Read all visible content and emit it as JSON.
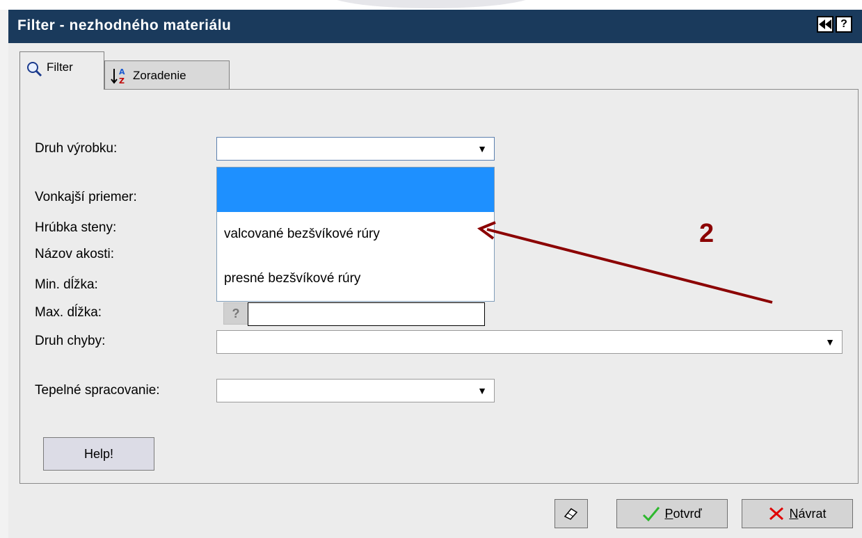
{
  "window": {
    "title": "Filter - nezhodného materiálu",
    "rewind_symbol": "◀◀",
    "help_symbol": "?"
  },
  "tabs": [
    {
      "label": "Filter",
      "icon": "magnifier-icon",
      "active": true
    },
    {
      "label": "Zoradenie",
      "icon": "sort-az-icon",
      "active": false
    }
  ],
  "form": {
    "druh_vyrobku": {
      "label": "Druh výrobku:",
      "value": ""
    },
    "vonkajsi_priemer": {
      "label": "Vonkajší priemer:"
    },
    "hrubka_steny": {
      "label": "Hrúbka steny:"
    },
    "nazov_akosti": {
      "label": "Názov akosti:"
    },
    "min_dlzka": {
      "label": "Min. dĺžka:"
    },
    "max_dlzka": {
      "label": "Max. dĺžka:",
      "help_symbol": "?",
      "value": ""
    },
    "druh_chyby": {
      "label": "Druh chyby:",
      "value": ""
    },
    "tepelne_spracovanie": {
      "label": "Tepelné spracovanie:",
      "value": ""
    },
    "dropdown_arrow": "▼"
  },
  "dropdown": {
    "options": [
      "",
      "valcované bezšvíkové rúry",
      "presné bezšvíkové rúry"
    ],
    "highlighted_index": 0,
    "highlight_color": "#1e90ff"
  },
  "buttons": {
    "help": "Help!",
    "confirm": "Potvrď",
    "back": "Návrat",
    "eraser_icon": "eraser-icon"
  },
  "annotation": {
    "number": "2",
    "color": "#8b0000"
  },
  "colors": {
    "titlebar": "#1a3a5c",
    "panel": "#ececec"
  }
}
